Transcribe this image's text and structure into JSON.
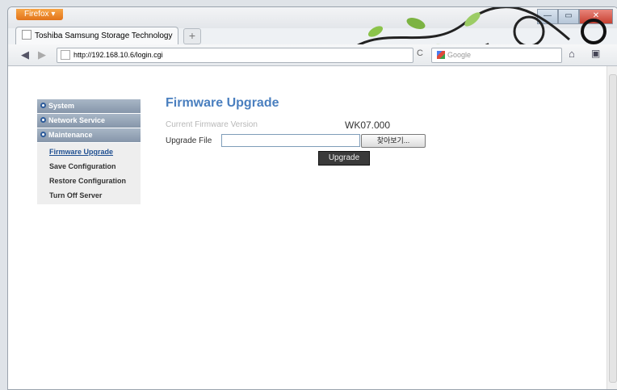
{
  "browser": {
    "app_button": "Firefox ▾",
    "tab_title": "Toshiba Samsung Storage Technology",
    "new_tab": "+",
    "url": "http://192.168.10.6/login.cgi",
    "search_placeholder": "Google",
    "controls": {
      "minimize": "—",
      "maximize": "▭",
      "close": "✕"
    },
    "back": "◀",
    "forward": "▶",
    "reload": "C",
    "home": "⌂",
    "extension": "▣"
  },
  "sidebar": {
    "sections": [
      {
        "label": "System"
      },
      {
        "label": "Network Service"
      },
      {
        "label": "Maintenance"
      }
    ],
    "items": [
      {
        "label": "Firmware Upgrade",
        "active": true
      },
      {
        "label": "Save Configuration"
      },
      {
        "label": "Restore Configuration"
      },
      {
        "label": "Turn Off Server"
      }
    ]
  },
  "main": {
    "title": "Firmware Upgrade",
    "fw_label": "Current Firmware Version",
    "fw_value": "WK07.000",
    "file_label": "Upgrade File",
    "file_value": "",
    "browse_label": "찾아보기...",
    "upgrade_label": "Upgrade"
  },
  "colors": {
    "title": "#4a7fbf",
    "sidebar_section": "#8d9caf",
    "upgrade_button": "#3a3a3a",
    "firefox_button": "#e8791f"
  }
}
